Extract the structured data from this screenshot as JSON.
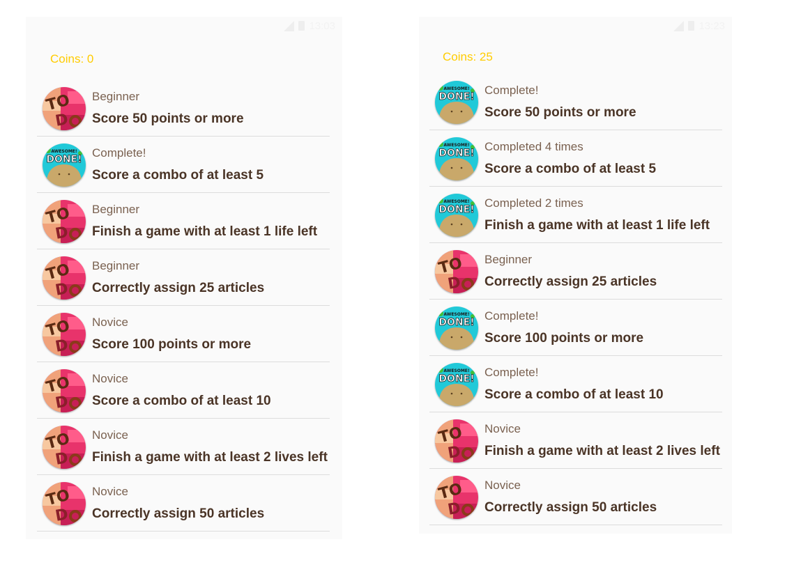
{
  "screens": [
    {
      "coins": "Coins: 0",
      "time": "13:03",
      "achievements": [
        {
          "badge": "todo",
          "status": "Beginner",
          "title": "Score 50 points or more"
        },
        {
          "badge": "done",
          "status": "Complete!",
          "title": "Score a combo of at least 5"
        },
        {
          "badge": "todo",
          "status": "Beginner",
          "title": "Finish a game with at least 1 life left"
        },
        {
          "badge": "todo",
          "status": "Beginner",
          "title": "Correctly assign 25 articles"
        },
        {
          "badge": "todo",
          "status": "Novice",
          "title": "Score 100 points or more"
        },
        {
          "badge": "todo",
          "status": "Novice",
          "title": "Score a combo of at least 10"
        },
        {
          "badge": "todo",
          "status": "Novice",
          "title": "Finish a game with at least 2 lives left"
        },
        {
          "badge": "todo",
          "status": "Novice",
          "title": "Correctly assign 50 articles"
        }
      ]
    },
    {
      "coins": "Coins: 25",
      "time": "13:23",
      "achievements": [
        {
          "badge": "done",
          "status": "Complete!",
          "title": "Score 50 points or more"
        },
        {
          "badge": "done",
          "status": "Completed 4 times",
          "title": "Score a combo of at least 5"
        },
        {
          "badge": "done",
          "status": "Completed 2 times",
          "title": "Finish a game with at least 1 life left"
        },
        {
          "badge": "todo",
          "status": "Beginner",
          "title": "Correctly assign 25 articles"
        },
        {
          "badge": "done",
          "status": "Complete!",
          "title": "Score 100 points or more"
        },
        {
          "badge": "done",
          "status": "Complete!",
          "title": "Score a combo of at least 10"
        },
        {
          "badge": "todo",
          "status": "Novice",
          "title": "Finish a game with at least 2 lives left"
        },
        {
          "badge": "todo",
          "status": "Novice",
          "title": "Correctly assign 50 articles"
        }
      ]
    }
  ],
  "badge_text": {
    "todo": "TODO",
    "done_top": "AWESOME!",
    "done_main": "DONE!"
  },
  "colors": {
    "coins": "#ffcc00",
    "status_text": "#7a6150",
    "title_text": "#4a3426",
    "divider": "#dcdcdc",
    "todo_pink": "#e8336b",
    "done_cyan": "#21c9d8",
    "potato": "#c9a86a"
  }
}
